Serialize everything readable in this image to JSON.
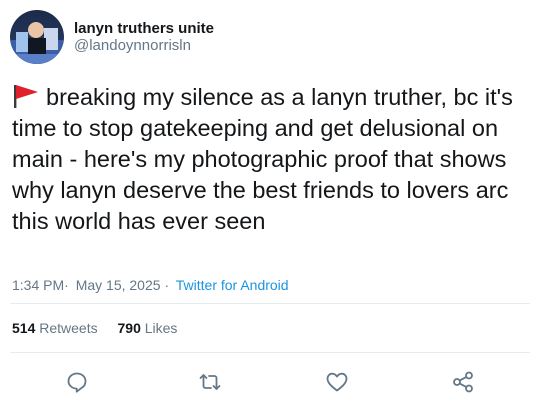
{
  "author": {
    "display_name": "lanyn truthers unite",
    "handle": "@landoynnorrisln"
  },
  "tweet": {
    "text": "breaking my silence as a lanyn truther, bc it's time to stop gatekeeping and get delusional on main - here's my photographic proof that shows why lanyn deserve the best friends to lovers arc this world has ever seen",
    "leading_emoji": "red-flag-icon"
  },
  "meta": {
    "time": "1:34 PM",
    "date": "May 15, 2025",
    "separator": "·",
    "source": "Twitter for Android"
  },
  "stats": {
    "retweets_count": "514",
    "retweets_label": "Retweets",
    "likes_count": "790",
    "likes_label": "Likes"
  },
  "actions": {
    "reply_icon": "reply-icon",
    "retweet_icon": "retweet-icon",
    "like_icon": "heart-icon",
    "share_icon": "share-icon"
  },
  "colors": {
    "text": "#14171a",
    "secondary": "#657786",
    "link": "#1b95e0",
    "divider": "#e6ecf0",
    "flag": "#e0202b"
  }
}
